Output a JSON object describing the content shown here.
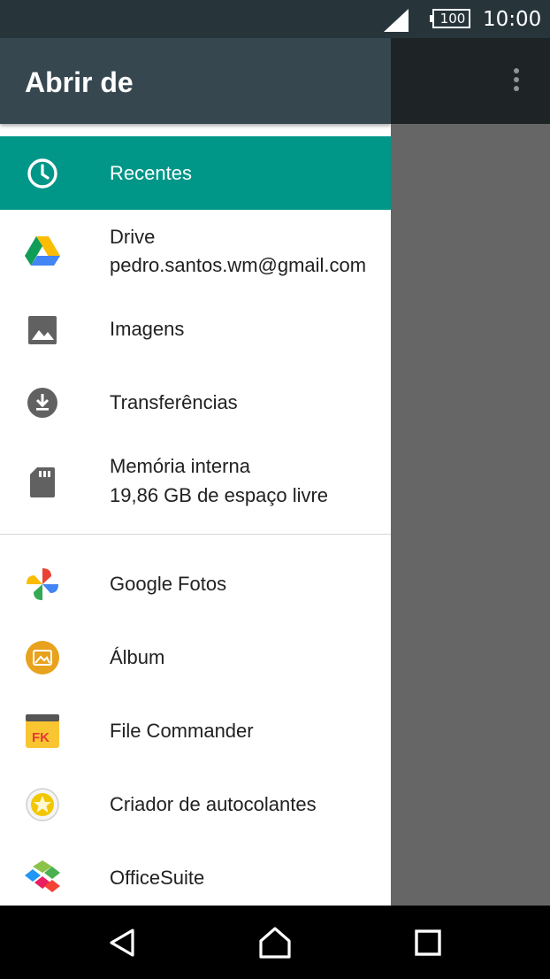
{
  "status_bar": {
    "battery": "100",
    "time": "10:00"
  },
  "drawer": {
    "title": "Abrir de",
    "items": [
      {
        "label": "Recentes",
        "icon": "clock-icon",
        "selected": true
      },
      {
        "label": "Drive",
        "sublabel": "pedro.santos.wm@gmail.com",
        "icon": "google-drive-icon"
      },
      {
        "label": "Imagens",
        "icon": "image-icon"
      },
      {
        "label": "Transferências",
        "icon": "download-icon"
      },
      {
        "label": "Memória interna",
        "sublabel": "19,86 GB de espaço livre",
        "icon": "sd-card-icon"
      },
      {
        "label": "Google Fotos",
        "icon": "google-photos-icon"
      },
      {
        "label": "Álbum",
        "icon": "album-app-icon"
      },
      {
        "label": "File Commander",
        "icon": "file-commander-icon"
      },
      {
        "label": "Criador de autocolantes",
        "icon": "sticker-creator-icon"
      },
      {
        "label": "OfficeSuite",
        "icon": "officesuite-icon"
      }
    ]
  },
  "colors": {
    "accent": "#009688",
    "header": "#37474f",
    "status_bar": "#27353b"
  }
}
